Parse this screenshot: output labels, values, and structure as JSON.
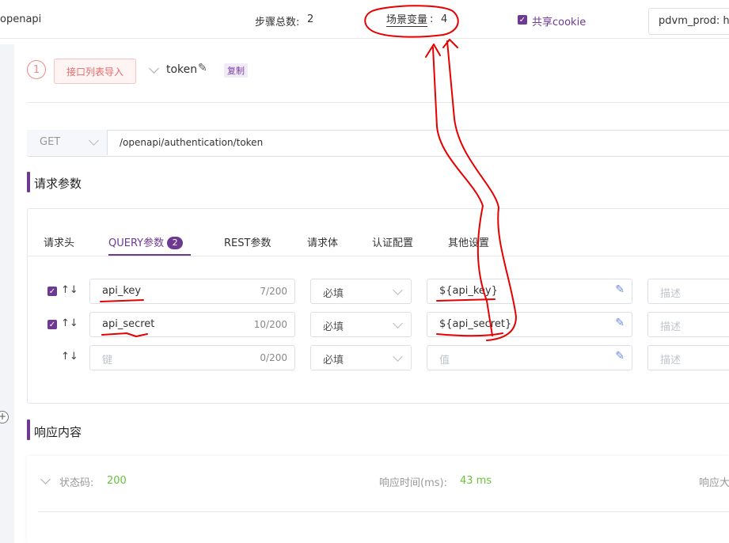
{
  "topbar": {
    "project_name": "openapi",
    "step_total_label": "步骤总数:",
    "step_total_value": "2",
    "scene_vars_label": "场景变量",
    "scene_vars_sep": ":",
    "scene_vars_value": "4",
    "share_cookie_label": "共享cookie",
    "env_select_value": "pdvm_prod: htt"
  },
  "step": {
    "index": "1",
    "import_button": "接口列表导入",
    "name": "token",
    "copy_tag": "复制"
  },
  "request": {
    "method": "GET",
    "url": "/openapi/authentication/token",
    "section_title": "请求参数"
  },
  "tabs": [
    {
      "label": "请求头"
    },
    {
      "label": "QUERY参数",
      "badge": "2"
    },
    {
      "label": "REST参数"
    },
    {
      "label": "请求体"
    },
    {
      "label": "认证配置"
    },
    {
      "label": "其他设置"
    }
  ],
  "params": [
    {
      "key": "api_key",
      "count": "7/200",
      "required": "必填",
      "value": "${api_key}",
      "desc_placeholder": "描述"
    },
    {
      "key": "api_secret",
      "count": "10/200",
      "required": "必填",
      "value": "${api_secret}",
      "desc_placeholder": "描述"
    },
    {
      "key_placeholder": "键",
      "count": "0/200",
      "required": "必填",
      "value_placeholder": "值",
      "desc_placeholder": "描述"
    }
  ],
  "response": {
    "section_title": "响应内容",
    "status_label": "状态码:",
    "status_value": "200",
    "time_label": "响应时间(ms):",
    "time_value": "43 ms",
    "size_label": "响应大"
  },
  "colors": {
    "accent": "#6e3a91",
    "success": "#67c23a",
    "annotation": "#e60000"
  }
}
